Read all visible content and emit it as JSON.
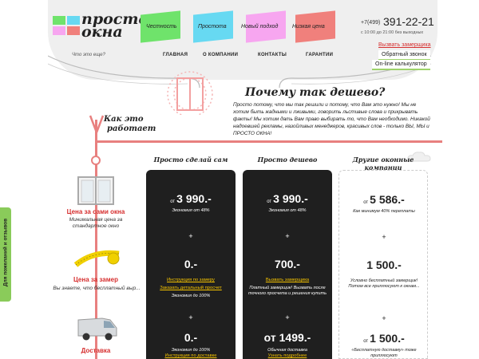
{
  "brand": {
    "logo_line1": "просто",
    "logo_line2": "окна",
    "tagline": "Что это еще?",
    "colors": [
      "#6fe36b",
      "#67d9f2",
      "#f7a6f0",
      "#f0807c"
    ]
  },
  "flags": [
    {
      "label": "Честность",
      "color": "#6fe36b"
    },
    {
      "label": "Простота",
      "color": "#67d9f2"
    },
    {
      "label": "Новый подход",
      "color": "#f7a6f0"
    },
    {
      "label": "Низкая цена",
      "color": "#f0807c"
    }
  ],
  "nav": [
    "ГЛАВНАЯ",
    "О КОМПАНИИ",
    "КОНТАКТЫ",
    "ГАРАНТИИ"
  ],
  "contact": {
    "phone_prefix": "+7(499)",
    "phone": "391-22-21",
    "hours": "с 10:00 до 21:00 без выходных",
    "call_measurer": "Вызвать замерщика",
    "callback": "Обратный звонок",
    "calculator": "On-line калькулятор"
  },
  "headline": {
    "title": "Почему так дешево?",
    "text": "Просто потому, что мы так решили и потому, что Вам это нужно! Мы не хотим быть жадными и лживыми, говорить льстивые слова и прикрывать факты! Мы хотим дать Вам право выбирать то, что Вам необходимо. Никакой надоевшей рекламы, назойливых менеджеров, красивых слов - только ВЫ, МЫ и ПРОСТО ОКНА!",
    "how_label_line1": "Как это",
    "how_label_line2": "работает"
  },
  "steps": [
    {
      "title": "Цена за сами окна",
      "sub": "Минимальная цена за стандартное окно"
    },
    {
      "title": "Цена за замер",
      "sub": "Вы знаете, что бесплатный выр..."
    },
    {
      "title": "Доставка",
      "sub": ""
    }
  ],
  "columns": [
    {
      "head": "Просто сделай сам",
      "price1_pre": "от",
      "price1": "3 990.-",
      "note1": "Экономия от 48%",
      "price2": "0.-",
      "link1": "Инструкция по замеру",
      "link2": "Заказать детальный просчет",
      "note2": "Экономия до 100%",
      "price3": "0.-",
      "note3": "Экономия до 100%",
      "link3": "Инструкция по доставке"
    },
    {
      "head": "Просто дешево",
      "price1_pre": "от",
      "price1": "3 990.-",
      "note1": "Экономия от 48%",
      "price2": "700.-",
      "link1": "Вызвать замерщика",
      "note2": "Платный замерщик! Вызвать после точного просчета и решения купить",
      "price3_pre": "от",
      "price3": "1499.-",
      "note3": "Обычная доставка",
      "link3": "Узнать подробнее"
    },
    {
      "head": "Другие оконные компании",
      "price1_pre": "от",
      "price1": "5 586.-",
      "note1": "Как минимум 40% переплаты",
      "price2": "1 500.-",
      "note2": "Условно бесплатный замерщик! Потом все приплюсуют к окнам...",
      "price3_pre": "от",
      "price3": "1 500.-",
      "note3": "«Бесплатную доставку» тоже приплюсуют"
    }
  ],
  "plus_sign": "+",
  "side_tab": "Для пожеланий и отзывов"
}
